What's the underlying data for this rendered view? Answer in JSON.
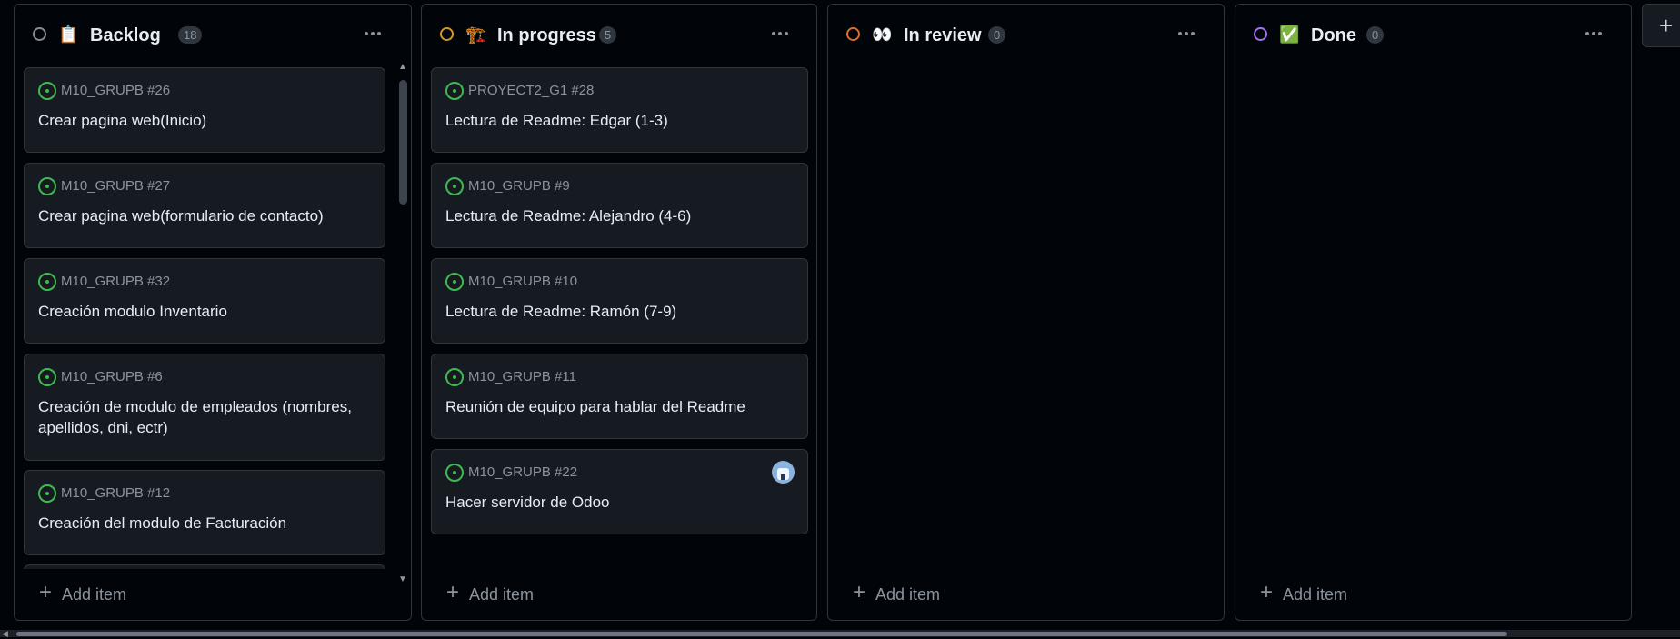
{
  "columns": [
    {
      "title": "Backlog",
      "emoji": "📋",
      "count": "18",
      "status_color": "#848d97",
      "add_item_label": "Add item",
      "cards": [
        {
          "ref": "M10_GRUPB #26",
          "title": "Crear pagina web(Inicio)"
        },
        {
          "ref": "M10_GRUPB #27",
          "title": "Crear pagina web(formulario de contacto)"
        },
        {
          "ref": "M10_GRUPB #32",
          "title": "Creación modulo Inventario"
        },
        {
          "ref": "M10_GRUPB #6",
          "title": "Creación de modulo de empleados (nombres, apellidos, dni, ectr)"
        },
        {
          "ref": "M10_GRUPB #12",
          "title": "Creación del modulo de Facturación"
        }
      ]
    },
    {
      "title": "In progress",
      "emoji": "🏗️",
      "count": "5",
      "status_color": "#d29922",
      "add_item_label": "Add item",
      "cards": [
        {
          "ref": "PROYECT2_G1 #28",
          "title": "Lectura de Readme: Edgar (1-3)"
        },
        {
          "ref": "M10_GRUPB #9",
          "title": "Lectura de Readme: Alejandro (4-6)"
        },
        {
          "ref": "M10_GRUPB #10",
          "title": "Lectura de Readme: Ramón (7-9)"
        },
        {
          "ref": "M10_GRUPB #11",
          "title": "Reunión de equipo para hablar del Readme"
        },
        {
          "ref": "M10_GRUPB #22",
          "title": "Hacer servidor de Odoo"
        }
      ]
    },
    {
      "title": "In review",
      "emoji": "👀",
      "count": "0",
      "status_color": "#db6d28",
      "add_item_label": "Add item",
      "cards": []
    },
    {
      "title": "Done",
      "emoji": "✅",
      "count": "0",
      "status_color": "#a371f7",
      "add_item_label": "Add item",
      "cards": []
    }
  ],
  "add_column_label": "+"
}
